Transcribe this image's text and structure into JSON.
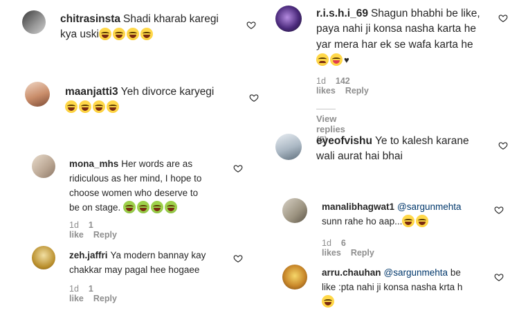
{
  "left": [
    {
      "user": "chitrasinsta",
      "text_lines": [
        "Shadi kharab karegi",
        "kya uski"
      ],
      "emojis": [
        "laugh",
        "laugh",
        "laugh",
        "laugh"
      ]
    },
    {
      "user": "maanjatti3",
      "text_lines": [
        "Yeh divorce karyegi"
      ],
      "emojis": [
        "laugh",
        "laugh",
        "laugh",
        "laugh"
      ]
    },
    {
      "user": "mona_mhs",
      "text_lines": [
        "Her words are as",
        "ridiculous as her mind, I hope to",
        "choose women who deserve to",
        "be on stage."
      ],
      "emojis": [
        "green",
        "green",
        "green",
        "green"
      ],
      "time": "1d",
      "likes": "1 like",
      "reply": "Reply"
    },
    {
      "user": "zeh.jaffri",
      "text_lines": [
        "Ya modern bannay kay",
        "chakkar may pagal hee hogaee"
      ],
      "time": "1d",
      "likes": "1 like",
      "reply": "Reply"
    }
  ],
  "right": [
    {
      "user": "r.i.s.h.i_69",
      "text_lines": [
        "Shagun bhabhi be like,",
        "paya nahi ji konsa nasha karta he",
        "yar mera har ek se wafa karta he"
      ],
      "emojis": [
        "sad",
        "tongue"
      ],
      "extra": "♥",
      "time": "1d",
      "likes": "142 likes",
      "reply": "Reply",
      "view_replies": "View replies (5)"
    },
    {
      "user": "eyeofvishu",
      "text_lines": [
        "Ye to kalesh karane",
        "wali aurat hai bhai"
      ]
    },
    {
      "user": "manalibhagwat1",
      "mention": "@sargunmehta",
      "text_lines": [
        "sunn rahe ho aap..."
      ],
      "emojis": [
        "laugh",
        "laugh"
      ],
      "time": "1d",
      "likes": "6 likes",
      "reply": "Reply"
    },
    {
      "user": "arru.chauhan",
      "mention": "@sargunmehta",
      "after_mention": "be",
      "text_lines": [
        "like :pta nahi ji konsa nasha krta h"
      ],
      "emojis": [
        "laugh"
      ]
    }
  ],
  "colors": {
    "text": "#262626",
    "meta": "#8e8e8e",
    "mention": "#00376b"
  },
  "icons": {
    "like": "heart-outline-icon"
  }
}
